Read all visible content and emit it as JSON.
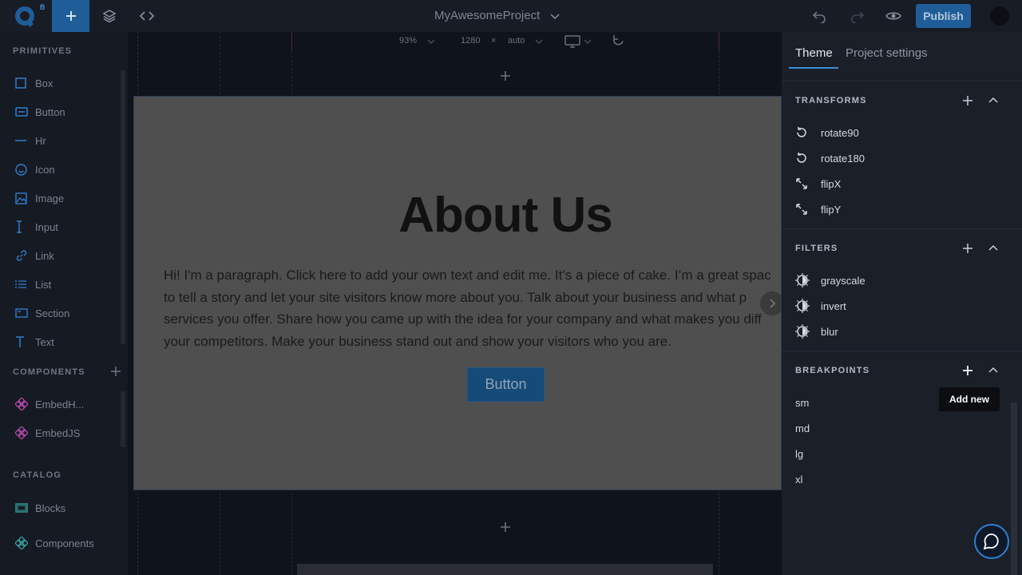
{
  "topbar": {
    "logo_badge": "B",
    "project_name": "MyAwesomeProject",
    "publish_label": "Publish"
  },
  "sidebar": {
    "primitives_title": "PRIMITIVES",
    "primitives": [
      {
        "label": "Box",
        "icon": "square-icon"
      },
      {
        "label": "Button",
        "icon": "button-icon"
      },
      {
        "label": "Hr",
        "icon": "hr-icon"
      },
      {
        "label": "Icon",
        "icon": "smiley-icon"
      },
      {
        "label": "Image",
        "icon": "image-icon"
      },
      {
        "label": "Input",
        "icon": "text-cursor-icon"
      },
      {
        "label": "Link",
        "icon": "link-icon"
      },
      {
        "label": "List",
        "icon": "list-icon"
      },
      {
        "label": "Section",
        "icon": "section-icon"
      },
      {
        "label": "Text",
        "icon": "text-icon"
      }
    ],
    "components_title": "COMPONENTS",
    "components": [
      {
        "label": "EmbedH...",
        "icon": "component-icon"
      },
      {
        "label": "EmbedJS",
        "icon": "component-icon"
      }
    ],
    "catalog_title": "CATALOG",
    "catalog": [
      {
        "label": "Blocks",
        "icon": "blocks-icon"
      },
      {
        "label": "Components",
        "icon": "component-icon"
      }
    ]
  },
  "viewbar": {
    "zoom": "93%",
    "width": "1280",
    "times": "×",
    "height": "auto"
  },
  "page": {
    "title": "About Us",
    "paragraph_lines": [
      "Hi! I'm a paragraph. Click here to add your own text and edit me. It’s a piece of cake. I’m a great spac",
      "to tell a story and let your site visitors know more about you. Talk about your business and what p",
      "services you offer. Share how you came up with the idea for your company and what makes you diff",
      "your competitors. Make your business stand out and show your visitors who you are."
    ],
    "button_label": "Button"
  },
  "rpanel": {
    "tab_theme": "Theme",
    "tab_project": "Project settings",
    "transforms_title": "TRANSFORMS",
    "transforms": [
      {
        "label": "rotate90",
        "icon": "rotate-icon"
      },
      {
        "label": "rotate180",
        "icon": "rotate-icon"
      },
      {
        "label": "flipX",
        "icon": "expand-icon"
      },
      {
        "label": "flipY",
        "icon": "expand-icon"
      }
    ],
    "filters_title": "FILTERS",
    "filters": [
      {
        "label": "grayscale",
        "icon": "brightness-icon"
      },
      {
        "label": "invert",
        "icon": "brightness-icon"
      },
      {
        "label": "blur",
        "icon": "brightness-icon"
      }
    ],
    "breakpoints_title": "BREAKPOINTS",
    "breakpoints": [
      "sm",
      "md",
      "lg",
      "xl"
    ],
    "tooltip": "Add new"
  },
  "colors": {
    "accent": "#1f5d99",
    "accent_light": "#3a8fd8",
    "component_pink": "#b04aa8",
    "primitive_blue": "#2f7fd0"
  }
}
